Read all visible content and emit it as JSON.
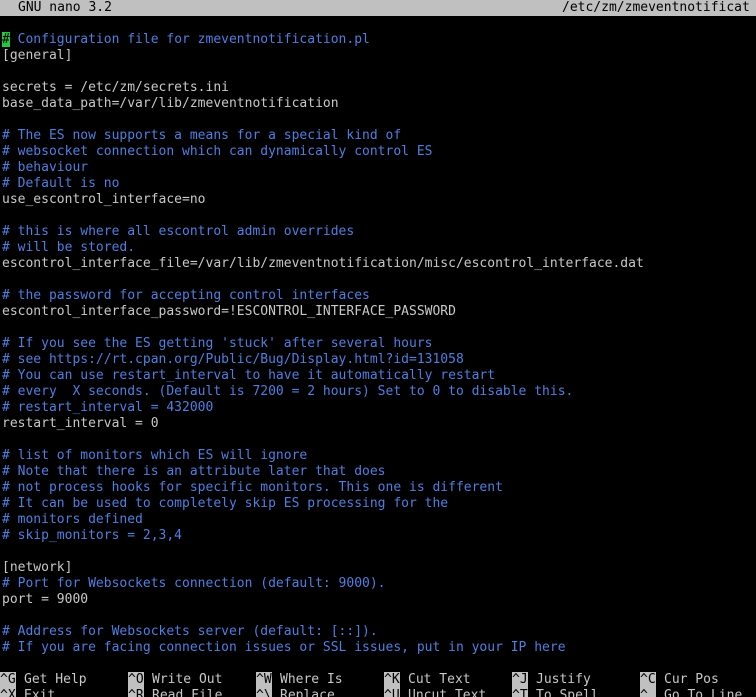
{
  "titlebar": {
    "app": "GNU nano 3.2",
    "path": "/etc/zm/zmeventnotificat"
  },
  "cursor_char": "#",
  "lines": [
    {
      "text": " Configuration file for zmeventnotification.pl",
      "type": "comment"
    },
    {
      "text": "[general]",
      "type": "code"
    },
    {
      "text": "",
      "type": "code"
    },
    {
      "text": "secrets = /etc/zm/secrets.ini",
      "type": "code"
    },
    {
      "text": "base_data_path=/var/lib/zmeventnotification",
      "type": "code"
    },
    {
      "text": "",
      "type": "code"
    },
    {
      "text": "# The ES now supports a means for a special kind of",
      "type": "comment"
    },
    {
      "text": "# websocket connection which can dynamically control ES",
      "type": "comment"
    },
    {
      "text": "# behaviour",
      "type": "comment"
    },
    {
      "text": "# Default is no",
      "type": "comment"
    },
    {
      "text": "use_escontrol_interface=no",
      "type": "code"
    },
    {
      "text": "",
      "type": "code"
    },
    {
      "text": "# this is where all escontrol admin overrides",
      "type": "comment"
    },
    {
      "text": "# will be stored.",
      "type": "comment"
    },
    {
      "text": "escontrol_interface_file=/var/lib/zmeventnotification/misc/escontrol_interface.dat",
      "type": "code"
    },
    {
      "text": "",
      "type": "code"
    },
    {
      "text": "# the password for accepting control interfaces",
      "type": "comment"
    },
    {
      "text": "escontrol_interface_password=!ESCONTROL_INTERFACE_PASSWORD",
      "type": "code"
    },
    {
      "text": "",
      "type": "code"
    },
    {
      "text": "# If you see the ES getting 'stuck' after several hours",
      "type": "comment"
    },
    {
      "text": "# see https://rt.cpan.org/Public/Bug/Display.html?id=131058",
      "type": "comment"
    },
    {
      "text": "# You can use restart_interval to have it automatically restart",
      "type": "comment"
    },
    {
      "text": "# every  X seconds. (Default is 7200 = 2 hours) Set to 0 to disable this.",
      "type": "comment"
    },
    {
      "text": "# restart_interval = 432000",
      "type": "comment"
    },
    {
      "text": "restart_interval = 0",
      "type": "code"
    },
    {
      "text": "",
      "type": "code"
    },
    {
      "text": "# list of monitors which ES will ignore",
      "type": "comment"
    },
    {
      "text": "# Note that there is an attribute later that does",
      "type": "comment"
    },
    {
      "text": "# not process hooks for specific monitors. This one is different",
      "type": "comment"
    },
    {
      "text": "# It can be used to completely skip ES processing for the",
      "type": "comment"
    },
    {
      "text": "# monitors defined",
      "type": "comment"
    },
    {
      "text": "# skip_monitors = 2,3,4",
      "type": "comment"
    },
    {
      "text": "",
      "type": "code"
    },
    {
      "text": "[network]",
      "type": "code"
    },
    {
      "text": "# Port for Websockets connection (default: 9000).",
      "type": "comment"
    },
    {
      "text": "port = 9000",
      "type": "code"
    },
    {
      "text": "",
      "type": "code"
    },
    {
      "text": "# Address for Websockets server (default: [::]).",
      "type": "comment"
    },
    {
      "text": "# If you are facing connection issues or SSL issues, put in your IP here",
      "type": "comment"
    }
  ],
  "shortcuts_row1": [
    {
      "key": "^G",
      "label": "Get Help"
    },
    {
      "key": "^O",
      "label": "Write Out"
    },
    {
      "key": "^W",
      "label": "Where Is"
    },
    {
      "key": "^K",
      "label": "Cut Text"
    },
    {
      "key": "^J",
      "label": "Justify"
    },
    {
      "key": "^C",
      "label": "Cur Pos"
    }
  ],
  "shortcuts_row2": [
    {
      "key": "^X",
      "label": "Exit"
    },
    {
      "key": "^R",
      "label": "Read File"
    },
    {
      "key": "^\\",
      "label": "Replace"
    },
    {
      "key": "^U",
      "label": "Uncut Text"
    },
    {
      "key": "^T",
      "label": "To Spell"
    },
    {
      "key": "^_",
      "label": "Go To Line"
    }
  ],
  "colors": {
    "background": "#000000",
    "titlebar": "#c0c0c0",
    "comment": "#4f7fe0",
    "code": "#c8c8c8",
    "cursor": "#22c93a"
  }
}
